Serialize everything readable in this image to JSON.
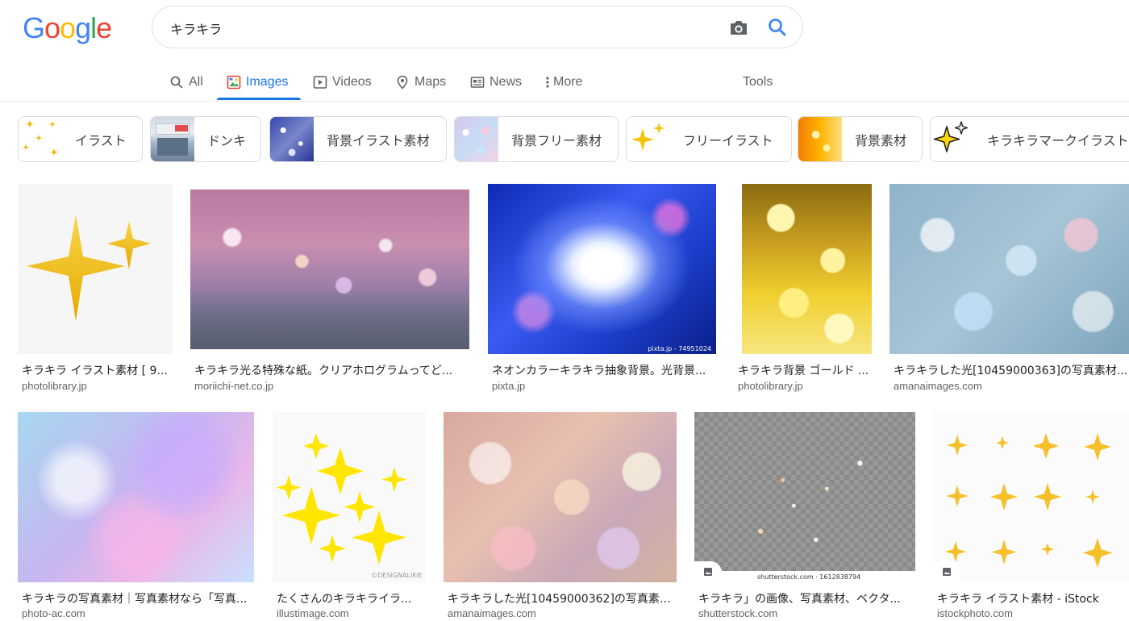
{
  "logo": {
    "letters": [
      "G",
      "o",
      "o",
      "g",
      "l",
      "e"
    ],
    "colors": [
      "#4285F4",
      "#EA4335",
      "#FBBC05",
      "#4285F4",
      "#34A853",
      "#EA4335"
    ]
  },
  "search": {
    "query": "キラキラ",
    "camera_icon": "camera-icon",
    "search_icon": "search-icon"
  },
  "tabs": [
    {
      "label": "All",
      "icon": "search-icon"
    },
    {
      "label": "Images",
      "icon": "image-icon"
    },
    {
      "label": "Videos",
      "icon": "play-icon"
    },
    {
      "label": "Maps",
      "icon": "map-pin-icon"
    },
    {
      "label": "News",
      "icon": "news-icon"
    },
    {
      "label": "More",
      "icon": "more-vert-icon"
    }
  ],
  "tools_label": "Tools",
  "active_tab": "Images",
  "chips": [
    {
      "label": "イラスト"
    },
    {
      "label": "ドンキ"
    },
    {
      "label": "背景イラスト素材"
    },
    {
      "label": "背景フリー素材"
    },
    {
      "label": "フリーイラスト"
    },
    {
      "label": "背景素材"
    },
    {
      "label": "キラキラマークイラスト"
    }
  ],
  "results_row1": [
    {
      "title": "キラキラ イラスト素材 [ 9...",
      "source": "photolibrary.jp"
    },
    {
      "title": "キラキラ光る特殊な紙。クリアホログラムってど...",
      "source": "moriichi-net.co.jp"
    },
    {
      "title": "ネオンカラーキラキラ抽象背景。光背景...",
      "source": "pixta.jp",
      "watermark": "pixta.jp - 74951024"
    },
    {
      "title": "キラキラ背景 ゴールド ...",
      "source": "photolibrary.jp"
    },
    {
      "title": "キラキラした光[10459000363]の写真素材...",
      "source": "amanaimages.com"
    }
  ],
  "results_row2": [
    {
      "title": "キラキラの写真素材｜写真素材なら「写真...",
      "source": "photo-ac.com"
    },
    {
      "title": "たくさんのキラキライラ...",
      "source": "illustimage.com",
      "watermark": "©DESIGNALIKIE"
    },
    {
      "title": "キラキラした光[10459000362]の写真素材...",
      "source": "amanaimages.com"
    },
    {
      "title": "キラキラ」の画像、写真素材、ベクタ...",
      "source": "shutterstock.com",
      "watermark": "shutterstock.com · 1612838794"
    },
    {
      "title": "キラキラ イラスト素材 - iStock",
      "source": "istockphoto.com"
    }
  ]
}
